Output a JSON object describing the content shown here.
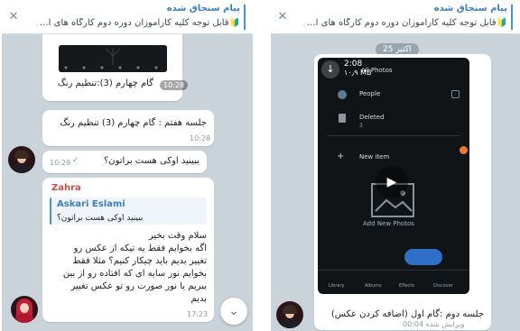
{
  "left": {
    "pinned": {
      "title": "پیام سنجاق شده",
      "text": "🔰قابل توجه کلیه کارآموزان دوره دوم کارگاه های آموزش..."
    },
    "media_caption": "گام چهارم (3):تنظیم رنگ",
    "media_time": "10:28",
    "messages": [
      {
        "text": "جلسه هفتم : گام چهارم (3) تنظیم رنگ",
        "time": "10:28"
      },
      {
        "text": "ببینید اوکی هست براتون؟",
        "time": "10:29"
      }
    ],
    "reply": {
      "sender": "Zahra",
      "quoted_sender": "Askari Eslami",
      "quoted_text": "ببینید اوکی هست براتون؟",
      "lines": [
        "سلام وقت بخیر",
        "اگه بخوایم فقط یه تیکه از عکس رو",
        "تغییر بدیم باید چیکار کنیم؟ مثلا فقط",
        "بخوایم نور سایه ای که افتاده رو از بین",
        "ببریم یا نور صورت رو تو عکس تغییر",
        "بدیم"
      ],
      "time": "17:23"
    },
    "scroll_icon": "chevron-down-icon"
  },
  "right": {
    "pinned": {
      "title": "پیام سنجاق شده",
      "text": "🔰قابل توجه کلیه کارآموزان دوره دوم کارگاه های آموزش..."
    },
    "date_pill": "اکتبر 25",
    "video": {
      "duration": "2:08",
      "size": "۱۰٫۹ MB",
      "menu_items": [
        "All Photos",
        "People",
        "Deleted",
        "New item"
      ],
      "deleted_count": "3",
      "overlay_label": "Add New Photos",
      "tabs": [
        "Library",
        "Albums",
        "Effects",
        "Discover"
      ]
    },
    "caption": "جلسه دوم :گام اول (اضافه کردن عکس)",
    "edited": "ویرایش شده 00:04",
    "accent": "#4a90d9"
  }
}
